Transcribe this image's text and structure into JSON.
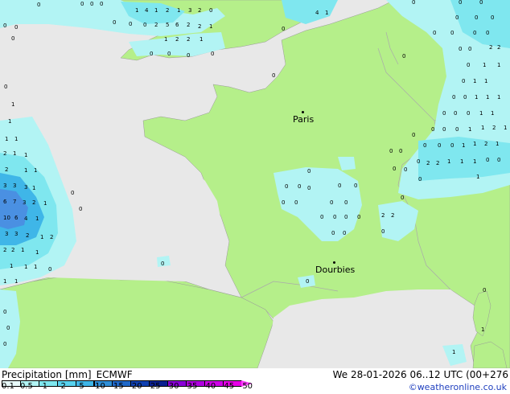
{
  "map": {
    "colors": {
      "sea": "#e8e8e8",
      "land": "#b5ef8a",
      "precip_light": "#b2f4f4",
      "precip_mid": "#7fe7ef",
      "precip_heavy": "#3fb6e8",
      "precip_strong": "#4a90e2",
      "border": "#aaaaaa"
    },
    "cities": [
      {
        "name": "Paris"
      },
      {
        "name": "Dourbies"
      }
    ]
  },
  "legend": {
    "title": "Precipitation [mm]",
    "model": "ECMWF",
    "datetime": "We 28-01-2026 06..12 UTC (00+276",
    "credit": "©weatheronline.co.uk",
    "ticks": [
      "0.1",
      "0.5",
      "1",
      "2",
      "5",
      "10",
      "15",
      "20",
      "25",
      "30",
      "35",
      "40",
      "45",
      "50"
    ],
    "colors": [
      "#e8fafa",
      "#b2f4f4",
      "#7fe7ef",
      "#58d2ef",
      "#3fb6e8",
      "#2f8fd8",
      "#2068c8",
      "#1040b0",
      "#0a2090",
      "#8a00d8",
      "#b000e0",
      "#d000e8",
      "#e800e8",
      "#ff40ff"
    ]
  }
}
